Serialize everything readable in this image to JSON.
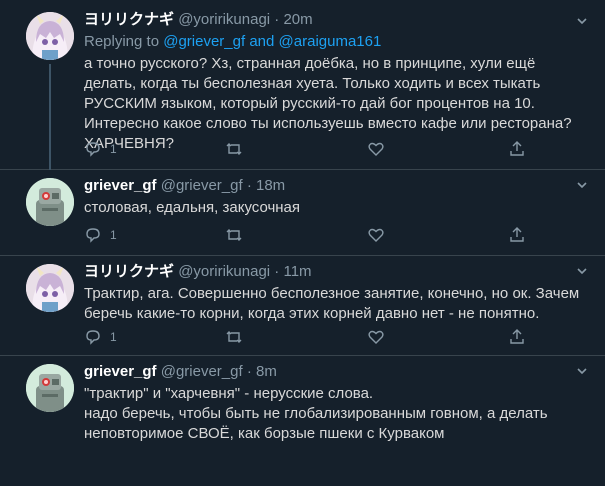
{
  "tweets": [
    {
      "name": "ヨリリクナギ",
      "handle": "@yoririkunagi",
      "sep": "·",
      "time": "20m",
      "replying_prefix": "Replying to",
      "replying_user1": "@griever_gf",
      "replying_and": "and",
      "replying_user2": "@araiguma161",
      "text": "а точно русского? Хз, странная доёбка, но в принципе, хули ещё делать, когда ты бесполезная хуета. Только ходить и всех тыкать РУССКИМ языком, который русский-то дай бог процентов на 10. Интересно какое слово ты используешь вместо кафе или ресторана? ХАРЧЕВНЯ?",
      "reply_count": "1"
    },
    {
      "name": "griever_gf",
      "handle": "@griever_gf",
      "sep": "·",
      "time": "18m",
      "text": "столовая, едальня, закусочная",
      "reply_count": "1"
    },
    {
      "name": "ヨリリクナギ",
      "handle": "@yoririkunagi",
      "sep": "·",
      "time": "11m",
      "text": "Трактир, ага. Совершенно бесполезное занятие, конечно, но ок. Зачем беречь какие-то корни, когда этих корней давно нет - не понятно.",
      "reply_count": "1"
    },
    {
      "name": "griever_gf",
      "handle": "@griever_gf",
      "sep": "·",
      "time": "8m",
      "text_line1": "\"трактир\" и \"харчевня\" - нерусские слова.",
      "text_line2": "надо беречь, чтобы быть не глобализированным говном, а делать неповторимое СВОЁ, как борзые пшеки с Курваком"
    }
  ],
  "icons": {
    "reply": "reply-icon",
    "retweet": "retweet-icon",
    "like": "heart-icon",
    "share": "share-icon",
    "more": "caret-down-icon"
  },
  "colors": {
    "background": "#15202b",
    "link": "#1da1f2",
    "muted": "#8899a6",
    "divider": "#38444d"
  }
}
